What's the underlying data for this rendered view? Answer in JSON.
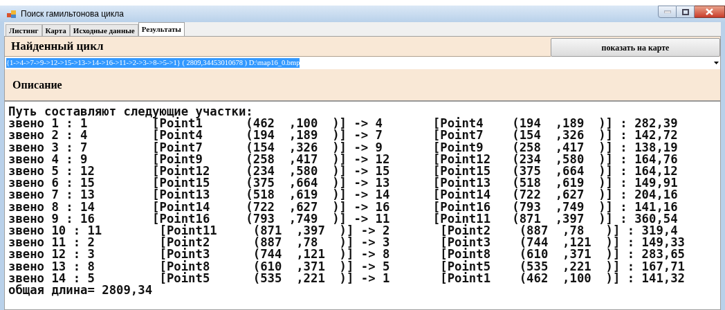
{
  "window": {
    "title": "Поиск гамильтонова цикла"
  },
  "tabs": [
    {
      "label": "Листинг",
      "selected": false
    },
    {
      "label": "Карта",
      "selected": false
    },
    {
      "label": "Исходные данные",
      "selected": false
    },
    {
      "label": "Результаты",
      "selected": true
    }
  ],
  "found_cycle": {
    "heading": "Найденный цикл",
    "button": "показать на карте",
    "value": "{1->4->7->9->12->15->13->14->16->11->2->3->8->5->1} ( 2809,34453010678 ) D:\\map16_0.bmp",
    "value_selected": true
  },
  "description": {
    "heading": "Описание"
  },
  "output": {
    "lines": [
      "Путь составляют следующие участки:",
      "звено 1 : 1         [Point1      (462  ,100  )] -> 4       [Point4    (194  ,189  )] : 282,39",
      "звено 2 : 4         [Point4      (194  ,189  )] -> 7       [Point7    (154  ,326  )] : 142,72",
      "звено 3 : 7         [Point7      (154  ,326  )] -> 9       [Point9    (258  ,417  )] : 138,19",
      "звено 4 : 9         [Point9      (258  ,417  )] -> 12      [Point12   (234  ,580  )] : 164,76",
      "звено 5 : 12        [Point12     (234  ,580  )] -> 15      [Point15   (375  ,664  )] : 164,12",
      "звено 6 : 15        [Point15     (375  ,664  )] -> 13      [Point13   (518  ,619  )] : 149,91",
      "звено 7 : 13        [Point13     (518  ,619  )] -> 14      [Point14   (722  ,627  )] : 204,16",
      "звено 8 : 14        [Point14     (722  ,627  )] -> 16      [Point16   (793  ,749  )] : 141,16",
      "звено 9 : 16        [Point16     (793  ,749  )] -> 11      [Point11   (871  ,397  )] : 360,54",
      "звено 10 : 11        [Point11     (871  ,397  )] -> 2       [Point2    (887  ,78   )] : 319,4",
      "звено 11 : 2         [Point2      (887  ,78   )] -> 3       [Point3    (744  ,121  )] : 149,33",
      "звено 12 : 3         [Point3      (744  ,121  )] -> 8       [Point8    (610  ,371  )] : 283,65",
      "звено 13 : 8         [Point8      (610  ,371  )] -> 5       [Point5    (535  ,221  )] : 167,71",
      "звено 14 : 5         [Point5      (535  ,221  )] -> 1       [Point1    (462  ,100  )] : 141,32",
      "общая длина= 2809,34"
    ]
  }
}
